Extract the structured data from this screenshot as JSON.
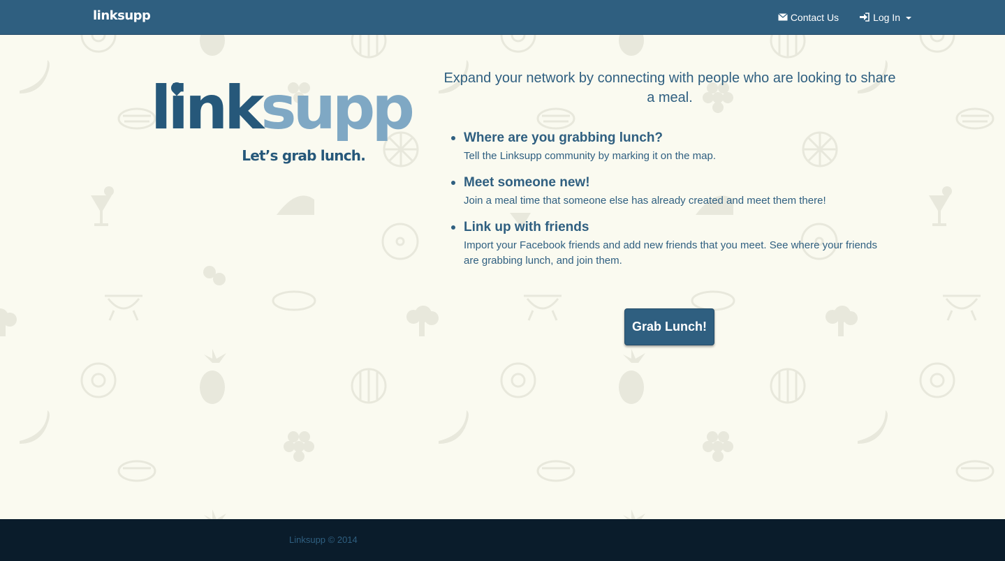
{
  "navbar": {
    "brand": "linksupp",
    "contact_label": "Contact Us",
    "login_label": "Log In"
  },
  "logo": {
    "word_dark": "link",
    "word_light": "supp",
    "tagline": "Let’s grab lunch."
  },
  "intro": "Expand your network by connecting with people who are looking to share a meal.",
  "features": [
    {
      "title": "Where are you grabbing lunch?",
      "description": "Tell the Linksupp community by marking it on the map."
    },
    {
      "title": "Meet someone new!",
      "description": "Join a meal time that someone else has already created and meet them there!"
    },
    {
      "title": "Link up with friends",
      "description": "Import your Facebook friends and add new friends that you meet. See where your friends are grabbing lunch, and join them."
    }
  ],
  "cta_label": "Grab Lunch!",
  "footer": {
    "copyright": "Linksupp © 2014"
  },
  "colors": {
    "navbar": "#2f5f80",
    "background": "#fafaf0",
    "logo_dark": "#26587a",
    "logo_light": "#7fa8c4",
    "footer": "#0a1c2b",
    "doodle": "#e8e8dc"
  },
  "icons": {
    "contact": "envelope-icon",
    "login": "sign-in-icon",
    "dropdown": "caret-down-icon",
    "background": [
      "donut-icon",
      "pineapple-icon",
      "watermelon-icon",
      "banana-icon",
      "grapes-icon",
      "steak-icon",
      "cocktail-icon",
      "turkey-icon",
      "cherries-icon",
      "grill-icon",
      "broccoli-icon",
      "pizza-icon",
      "orange-icon"
    ]
  }
}
